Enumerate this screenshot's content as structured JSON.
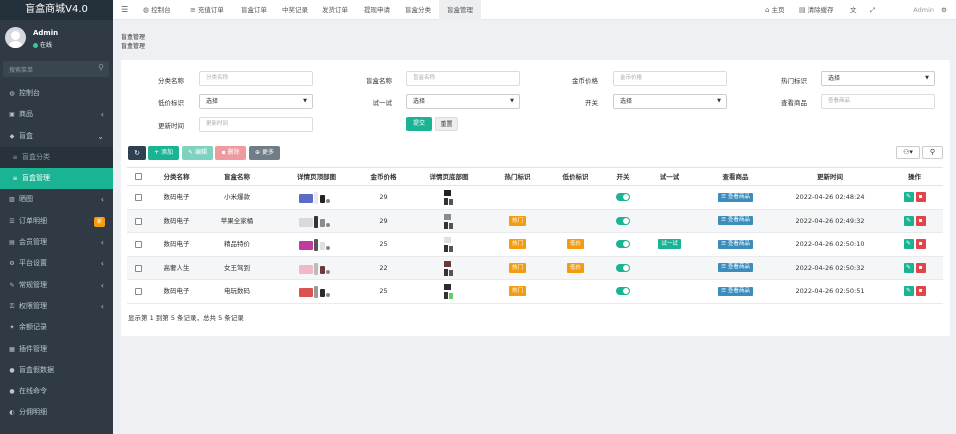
{
  "app": {
    "title": "盲盒商城V4.0"
  },
  "user": {
    "name": "Admin",
    "status": "在线"
  },
  "sidebar": {
    "search_placeholder": "搜索菜单",
    "items": [
      {
        "icon": "dashboard-icon",
        "label": "控制台"
      },
      {
        "icon": "goods-icon",
        "label": "商品"
      },
      {
        "icon": "blindbox-icon",
        "label": "盲盒"
      },
      {
        "icon": "list-icon",
        "label": "盲盒分类"
      },
      {
        "icon": "list-icon",
        "label": "盲盒管理"
      },
      {
        "icon": "image-icon",
        "label": "晒图"
      },
      {
        "icon": "order-icon",
        "label": "订单明细",
        "badge": "新"
      },
      {
        "icon": "member-icon",
        "label": "会员管理"
      },
      {
        "icon": "settings-icon",
        "label": "平台设置"
      },
      {
        "icon": "config-icon",
        "label": "常规管理"
      },
      {
        "icon": "permission-icon",
        "label": "权限管理"
      },
      {
        "icon": "balance-icon",
        "label": "余额记录"
      },
      {
        "icon": "plugin-icon",
        "label": "插件管理"
      },
      {
        "icon": "fake-data-icon",
        "label": "盲盒假数据"
      },
      {
        "icon": "command-icon",
        "label": "在线命令"
      },
      {
        "icon": "commission-icon",
        "label": "分佣明细"
      }
    ]
  },
  "topbar": {
    "tabs": [
      "控制台",
      "充值订单",
      "盲盒订单",
      "中奖记录",
      "发货订单",
      "提现申请",
      "盲盒分类",
      "盲盒管理"
    ],
    "home": "主页",
    "clear_cache": "清除缓存",
    "admin": "Admin"
  },
  "breadcrumb": {
    "title": "盲盒管理",
    "sub": "盲盒管理"
  },
  "filters": {
    "category_label": "分类名称",
    "category_ph": "分类名称",
    "name_label": "盲盒名称",
    "name_ph": "盲盒名称",
    "price_label": "金币价格",
    "price_ph": "金币价格",
    "hot_label": "热门标识",
    "hot_value": "选择",
    "low_label": "低价标识",
    "low_value": "选择",
    "try_label": "试一试",
    "try_value": "选择",
    "switch_label": "开关",
    "switch_value": "选择",
    "view_label": "查看商品",
    "view_ph": "查看商品",
    "time_label": "更新时间",
    "time_ph": "更新时间",
    "submit": "提交",
    "reset": "重置"
  },
  "toolbar": {
    "add": "添加",
    "edit": "编辑",
    "delete": "删除",
    "more": "更多"
  },
  "table": {
    "headers": [
      "分类名称",
      "盲盒名称",
      "详情页顶部图",
      "金币价格",
      "详情页底部图",
      "热门标识",
      "低价标识",
      "开关",
      "试一试",
      "查看商品",
      "更新时间",
      "操作"
    ],
    "rows": [
      {
        "category": "数码电子",
        "name": "小米爆款",
        "price": "29",
        "hot": "",
        "low": "",
        "try": "",
        "view": "查看商品",
        "time": "2022-04-26 02:48:24"
      },
      {
        "category": "数码电子",
        "name": "苹果全家桶",
        "price": "29",
        "hot": "热门",
        "low": "",
        "try": "",
        "view": "查看商品",
        "time": "2022-04-26 02:49:32"
      },
      {
        "category": "数码电子",
        "name": "精品特价",
        "price": "25",
        "hot": "热门",
        "low": "低价",
        "try": "试一试",
        "view": "查看商品",
        "time": "2022-04-26 02:50:10"
      },
      {
        "category": "高奢人生",
        "name": "女王驾到",
        "price": "22",
        "hot": "热门",
        "low": "低价",
        "try": "",
        "view": "查看商品",
        "time": "2022-04-26 02:50:32"
      },
      {
        "category": "数码电子",
        "name": "电玩数码",
        "price": "25",
        "hot": "热门",
        "low": "",
        "try": "",
        "view": "查看商品",
        "time": "2022-04-26 02:50:51"
      }
    ]
  },
  "footer": {
    "summary": "显示第 1 到第 5 条记录，总共 5 条记录"
  },
  "colors": {
    "accent": "#1ab394",
    "sidebar": "#2f3a44",
    "hot": "#f39c12",
    "danger": "#e0454b",
    "info": "#3c8dbc"
  }
}
